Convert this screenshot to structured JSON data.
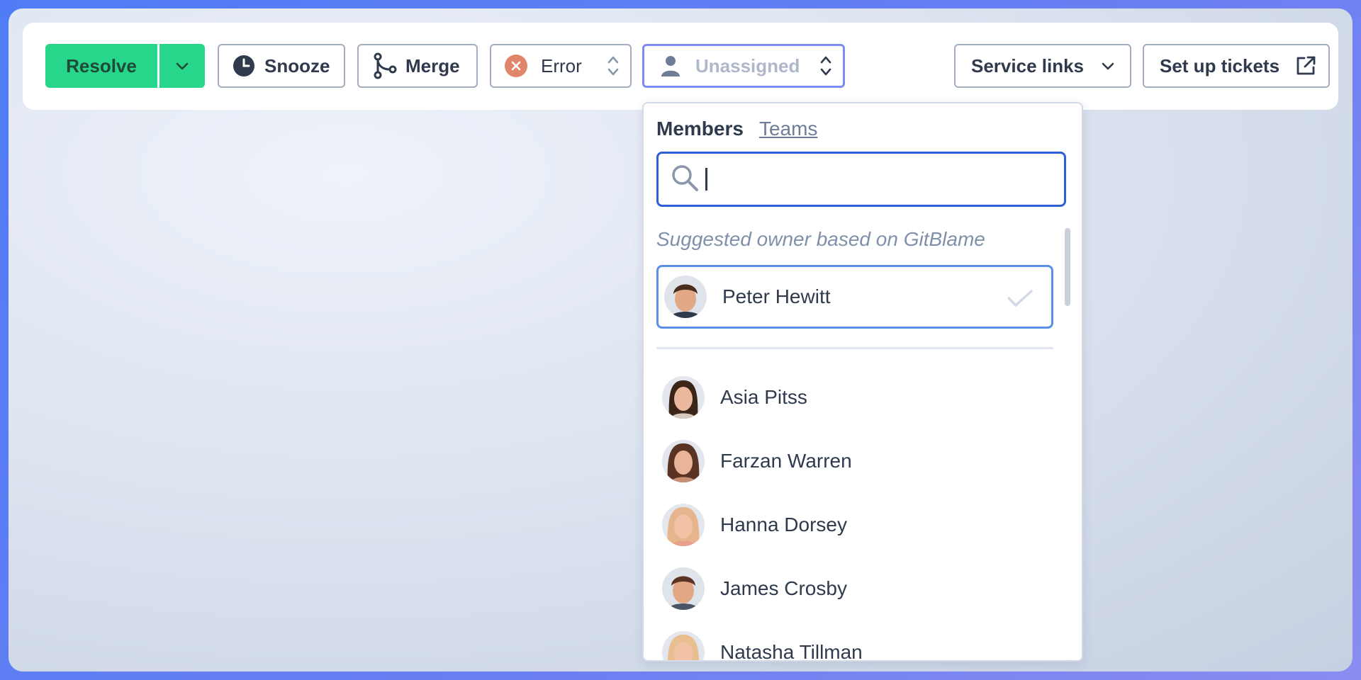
{
  "toolbar": {
    "resolve_label": "Resolve",
    "snooze_label": "Snooze",
    "merge_label": "Merge",
    "priority_label": "Error",
    "assignee_placeholder": "Unassigned",
    "service_links_label": "Service links",
    "tickets_label": "Set up tickets"
  },
  "assign_dropdown": {
    "tabs": [
      "Members",
      "Teams"
    ],
    "search_value": "",
    "suggested_heading": "Suggested owner based on GitBlame",
    "suggested": {
      "name": "Peter Hewitt"
    },
    "members": [
      {
        "name": "Asia Pitss"
      },
      {
        "name": "Farzan Warren"
      },
      {
        "name": "Hanna Dorsey"
      },
      {
        "name": "James Crosby"
      },
      {
        "name": "Natasha Tillman"
      }
    ]
  },
  "colors": {
    "resolve_green": "#28d68b",
    "focus_blue": "#2f5fd8",
    "error_orange": "#e0856a",
    "text_dark": "#2f3a4c"
  },
  "icons": [
    "chevron-down-icon",
    "clock-icon",
    "merge-icon",
    "error-icon",
    "sort-icon",
    "user-icon",
    "external-link-icon",
    "search-icon",
    "check-icon"
  ]
}
